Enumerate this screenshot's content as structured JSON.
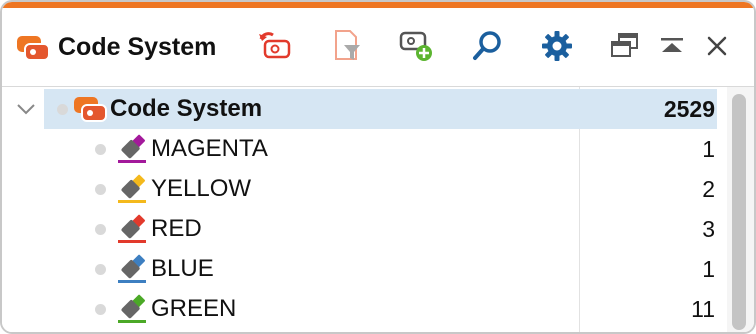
{
  "header": {
    "title": "Code System",
    "toolbar_icons": [
      "undo-code-icon",
      "filter-document-icon",
      "add-code-icon",
      "search-icon",
      "gear-icon",
      "window-restore-icon",
      "collapse-up-icon",
      "close-icon"
    ]
  },
  "tree": {
    "root": {
      "label": "Code System",
      "count": "2529"
    },
    "items": [
      {
        "label": "MAGENTA",
        "count": "1",
        "color": "#a3199b",
        "icon": "magenta-marker-icon"
      },
      {
        "label": "YELLOW",
        "count": "2",
        "color": "#f4b91c",
        "icon": "yellow-marker-icon"
      },
      {
        "label": "RED",
        "count": "3",
        "color": "#e23a2c",
        "icon": "red-marker-icon"
      },
      {
        "label": "BLUE",
        "count": "1",
        "color": "#3d7fc1",
        "icon": "blue-marker-icon"
      },
      {
        "label": "GREEN",
        "count": "11",
        "color": "#4ba927",
        "icon": "green-marker-icon"
      }
    ]
  },
  "colors": {
    "accent": "#ee7623",
    "selection": "#d6e6f3",
    "toolbar_blue": "#1b5f9e"
  }
}
